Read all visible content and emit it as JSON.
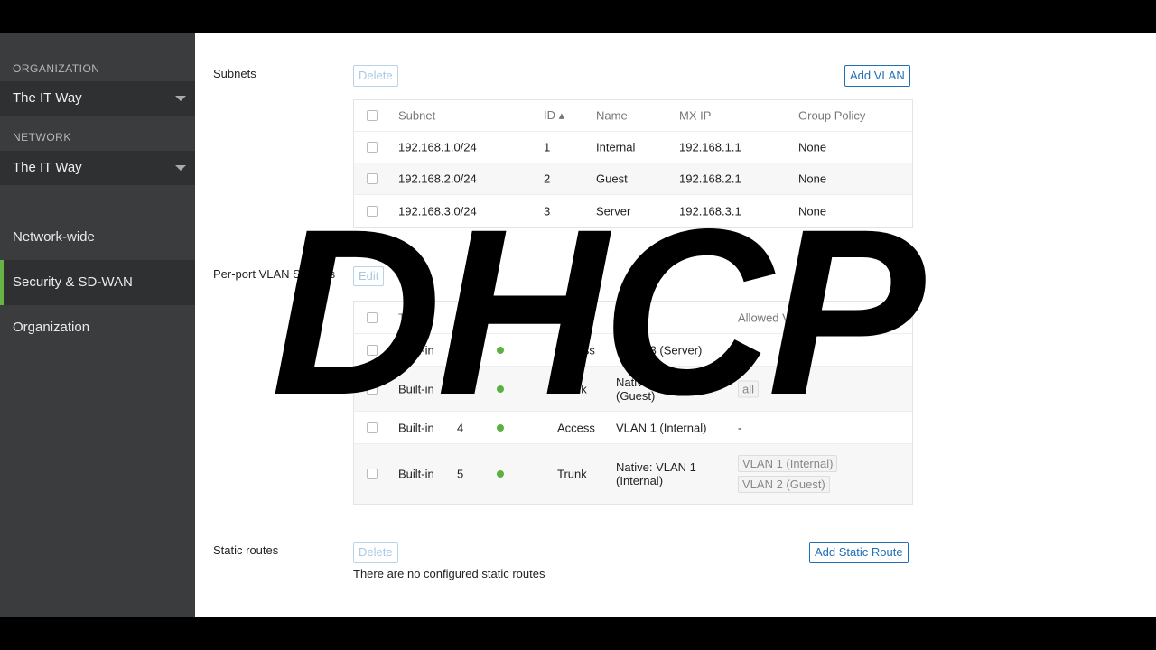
{
  "sidebar": {
    "org_label": "ORGANIZATION",
    "org_value": "The IT Way",
    "net_label": "NETWORK",
    "net_value": "The IT Way",
    "items": [
      {
        "label": "Network-wide"
      },
      {
        "label": "Security & SD-WAN",
        "active": true
      },
      {
        "label": "Organization"
      }
    ],
    "accent": "#67b346"
  },
  "subnets": {
    "title": "Subnets",
    "delete": "Delete",
    "add": "Add VLAN",
    "headers": [
      "Subnet",
      "ID ▴",
      "Name",
      "MX IP",
      "Group Policy"
    ],
    "rows": [
      [
        "192.168.1.0/24",
        "1",
        "Internal",
        "192.168.1.1",
        "None"
      ],
      [
        "192.168.2.0/24",
        "2",
        "Guest",
        "192.168.2.1",
        "None"
      ],
      [
        "192.168.3.0/24",
        "3",
        "Server",
        "192.168.3.1",
        "None"
      ]
    ]
  },
  "ports": {
    "title": "Per-port VLAN Settings",
    "edit": "Edit",
    "headers": [
      "Type",
      "Port",
      "Status",
      "Mode",
      "VLAN",
      "Allowed VLANs"
    ],
    "rows": [
      {
        "type": "Built-in",
        "port": "",
        "mode": "Access",
        "vlan": "VLAN 3 (Server)",
        "allowed": "-"
      },
      {
        "type": "Built-in",
        "port": "",
        "mode": "Trunk",
        "vlan": "Native: VLAN 2 (Guest)",
        "allowed_tag": "all"
      },
      {
        "type": "Built-in",
        "port": "4",
        "mode": "Access",
        "vlan": "VLAN 1 (Internal)",
        "allowed": "-"
      },
      {
        "type": "Built-in",
        "port": "5",
        "mode": "Trunk",
        "vlan": "Native: VLAN 1 (Internal)",
        "tags": [
          "VLAN 1 (Internal)",
          "VLAN 2 (Guest)"
        ]
      }
    ],
    "status_color": "#5cb043"
  },
  "static": {
    "title": "Static routes",
    "delete": "Delete",
    "add": "Add Static Route",
    "empty": "There are no configured static routes"
  },
  "overlay": "DHCP"
}
